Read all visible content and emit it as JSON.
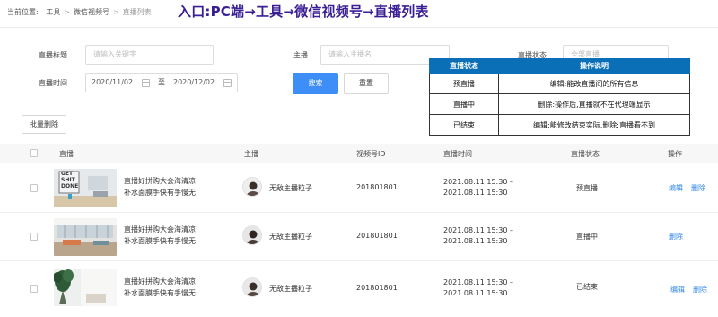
{
  "breadcrumb": {
    "prefix": "当前位置:",
    "items": [
      "工具",
      "微信视频号",
      "直播列表"
    ],
    "separator": ">"
  },
  "entry_title": "入口:PC端→工具→微信视频号→直播列表",
  "filters": {
    "title_label": "直播标题",
    "title_placeholder": "请输入关键字",
    "host_label": "主播",
    "host_placeholder": "请输入主播名",
    "status_label": "直播状态",
    "status_value": "全部直播",
    "time_label": "直播时间",
    "date_start": "2020/11/02",
    "date_to": "至",
    "date_end": "2020/12/02",
    "search_label": "搜索",
    "reset_label": "重置"
  },
  "status_table": {
    "header_status": "直播状态",
    "header_desc": "操作说明",
    "rows": [
      {
        "status": "预直播",
        "desc": "编辑:能改直播间的所有信息"
      },
      {
        "status": "直播中",
        "desc": "删除:操作后,直播就不在代理端显示"
      },
      {
        "status": "已结束",
        "desc": "编辑:能修改结束实际,删除:直播看不到"
      }
    ]
  },
  "batch_delete_label": "批量删除",
  "table": {
    "columns": [
      "直播",
      "主播",
      "视频号ID",
      "直播时间",
      "直播状态",
      "操作"
    ],
    "rows": [
      {
        "title_line1": "直播好拼购大会海清凉",
        "title_line2": "补水面膜手快有手慢无",
        "thumb_text_1": "GET",
        "thumb_text_2": "SHIT",
        "thumb_text_3": "DONE",
        "host": "无敌主播粒子",
        "video_id": "201801801",
        "time_line1": "2021.08.11 15:30 –",
        "time_line2": "2021.08.11 15:30",
        "status": "预直播",
        "action_edit": "编辑",
        "action_delete": "删除"
      },
      {
        "title_line1": "直播好拼购大会海清凉",
        "title_line2": "补水面膜手快有手慢无",
        "host": "无敌主播粒子",
        "video_id": "201801801",
        "time_line1": "2021.08.11 15:30 –",
        "time_line2": "2021.08.11 15:30",
        "status": "直播中",
        "action_delete": "删除"
      },
      {
        "title_line1": "直播好拼购大会海清凉",
        "title_line2": "补水面膜手快有手慢无",
        "host": "无敌主播粒子",
        "video_id": "201801801",
        "time_line1": "2021.08.11 15:30 –",
        "time_line2": "2021.08.11 15:30",
        "status": "已结束",
        "action_edit": "编辑",
        "action_delete": "删除"
      }
    ]
  },
  "colors": {
    "accent": "#3e8ef7",
    "link": "#2f86e8",
    "title_purple": "#3a1e94",
    "table_header_blue": "#0a6fb7"
  },
  "icons": [
    "calendar-icon",
    "chevron-down-icon",
    "checkbox-icon"
  ]
}
